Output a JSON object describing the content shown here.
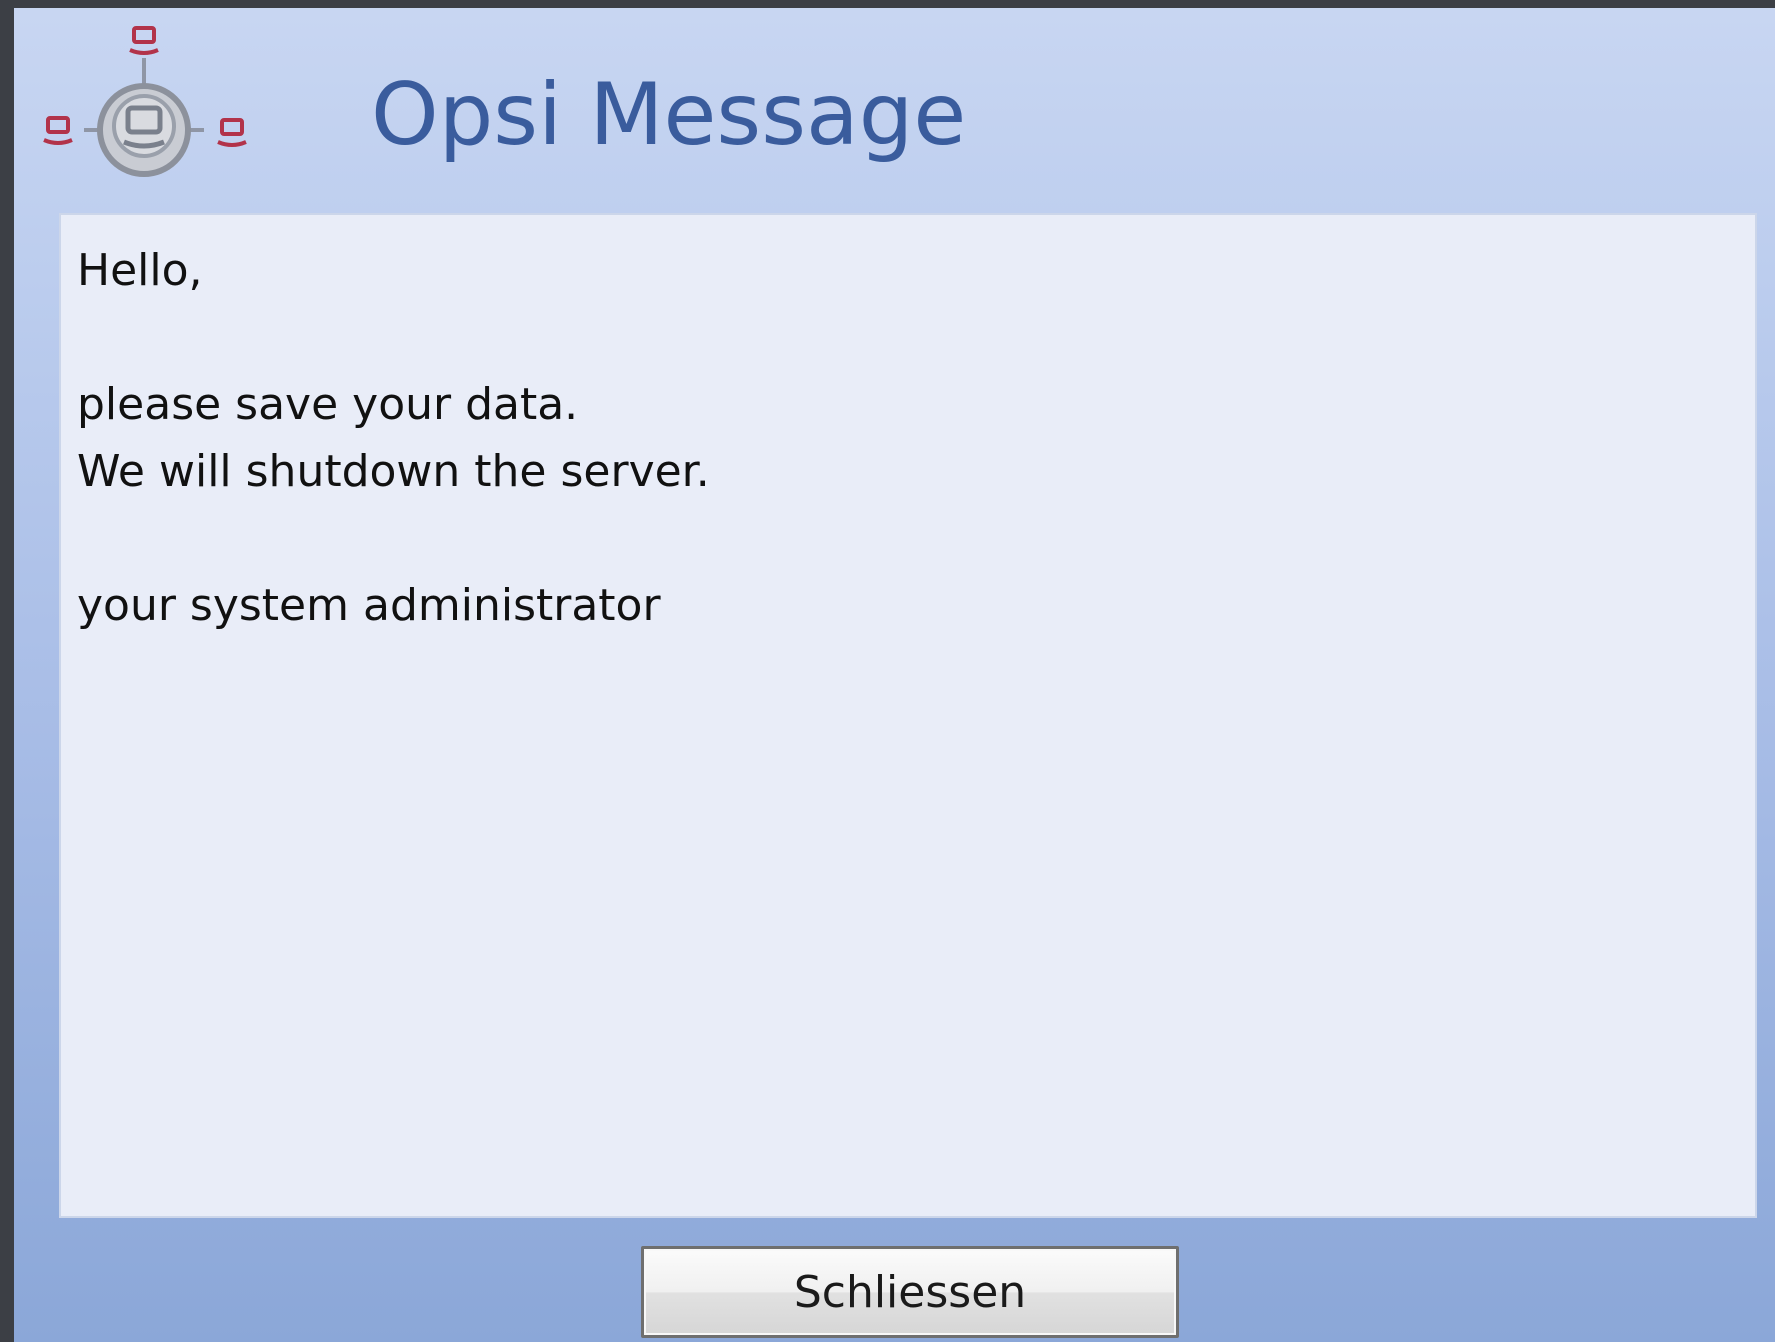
{
  "window": {
    "title": "Opsi Message"
  },
  "logo": {
    "icon": "opsi-network-logo-icon"
  },
  "message": {
    "lines": [
      "Hello,",
      "",
      "please save your data.",
      "We will shutdown the server.",
      "",
      "your system administrator"
    ]
  },
  "buttons": {
    "close_label": "Schliessen"
  },
  "colors": {
    "title": "#3a5c9d",
    "logo_accent": "#b2334a",
    "background_top": "#c8d6f2",
    "background_bottom": "#8ba7d8",
    "message_background": "#e9edf8"
  }
}
